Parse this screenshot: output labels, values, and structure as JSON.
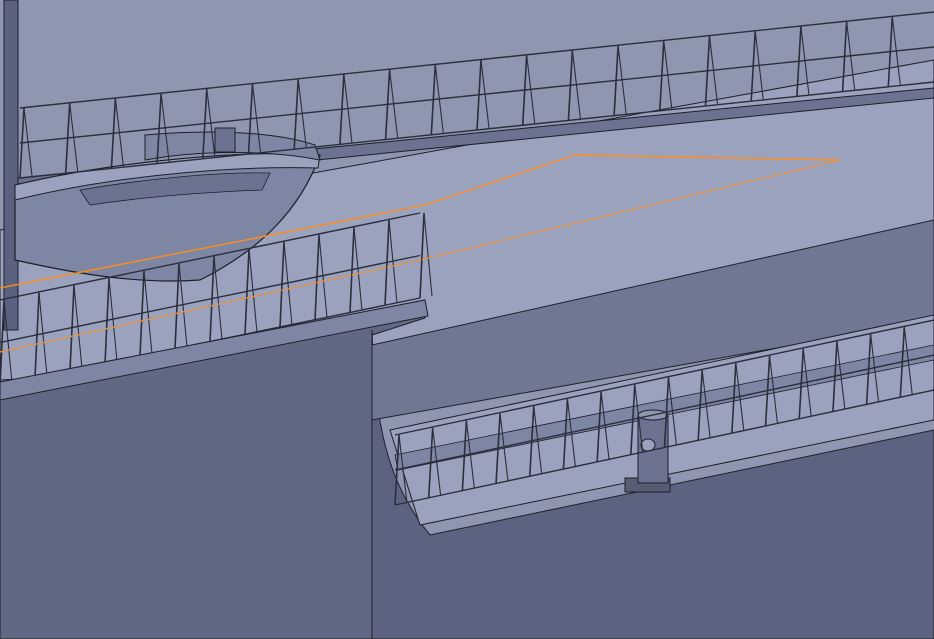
{
  "viewport": {
    "content": "3d-ship-model",
    "colors": {
      "background": "#8f97b0",
      "deck": "#9aa2bd",
      "hull_dark": "#565d75",
      "hull_mid": "#6b7390",
      "hull_light": "#7d86a3",
      "edge": "#1c1f2b",
      "rail": "#2a2e3d",
      "highlight": "#ff8c1a"
    },
    "selected_edge": "orange-highlight"
  }
}
